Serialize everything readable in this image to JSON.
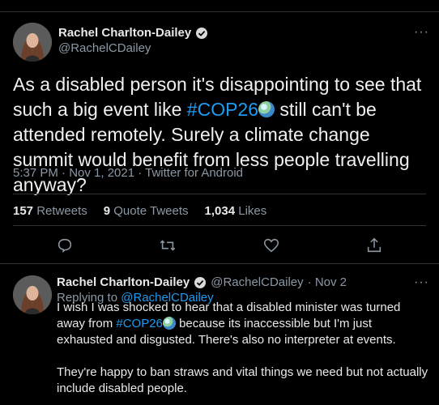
{
  "tweet": {
    "author_name": "Rachel Charlton-Dailey",
    "author_handle": "@RachelCDailey",
    "more_label": "···",
    "text_part1": "As a disabled person it's disappointing to see that such a big event like ",
    "hashtag": "#COP26",
    "text_part2": " still can't be attended remotely. Surely a climate change summit would benefit from less people travelling anyway?",
    "meta": "5:37 PM · Nov 1, 2021 · Twitter for Android",
    "stats": [
      {
        "value": "157",
        "label": "Retweets"
      },
      {
        "value": "9",
        "label": "Quote Tweets"
      },
      {
        "value": "1,034",
        "label": "Likes"
      }
    ],
    "icons": [
      "reply-icon",
      "retweet-icon",
      "like-icon",
      "share-icon"
    ]
  },
  "reply": {
    "author_name": "Rachel Charlton-Dailey",
    "author_handle": "@RachelCDailey",
    "date": "· Nov 2",
    "more_label": "···",
    "replying_to_label": "Replying to",
    "replying_to_handle": "@RachelCDailey",
    "p1_part1": "I wish I was shocked to hear that a disabled minister was turned away from ",
    "hashtag": "#COP26",
    "p1_part2": " because its inaccessible but I'm just exhausted and disgusted. There's also no interpreter at events.",
    "p2": "They're happy to ban straws and vital things we need but not actually include disabled people."
  },
  "colors": {
    "background": "#000000",
    "link": "#1d9bf0",
    "muted": "#8b98a5",
    "verified": "#d9d9d9"
  }
}
